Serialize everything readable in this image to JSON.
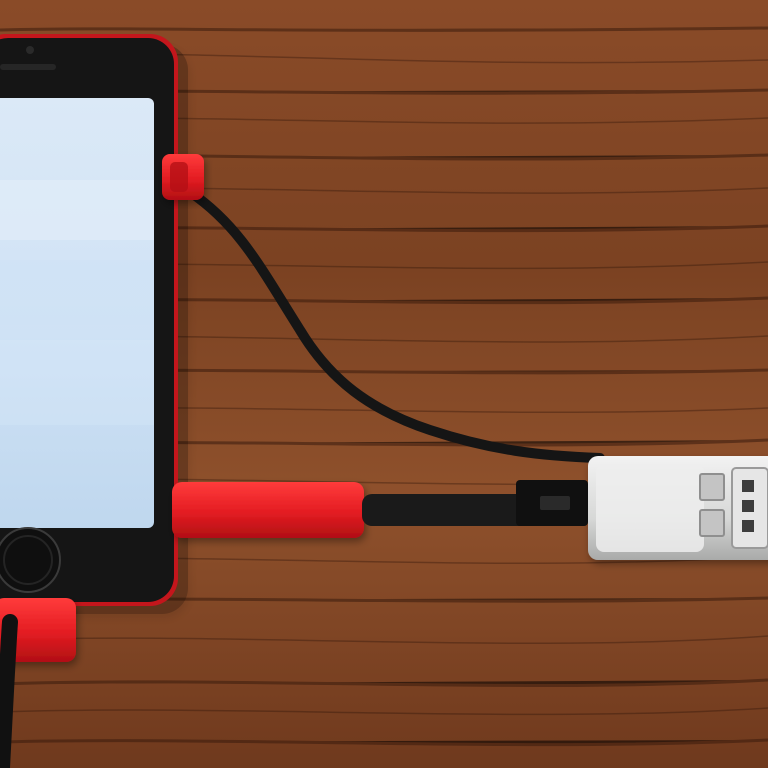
{
  "scene": {
    "description_free": true
  },
  "colors": {
    "wood_dark": "#4a2410",
    "wood_mid": "#7a4324",
    "wood_light": "#9b5a33",
    "phone_frame_red": "#c4161c",
    "phone_body_black": "#151515",
    "screen_light": "#d9e9f8",
    "cable_black": "#161616",
    "connector_red": "#e81f25",
    "adapter_gray": "#d8d9d8"
  },
  "icons": {
    "phone": "smartphone-icon",
    "cable": "usb-cable-icon",
    "adapter": "usb-adapter-icon"
  }
}
